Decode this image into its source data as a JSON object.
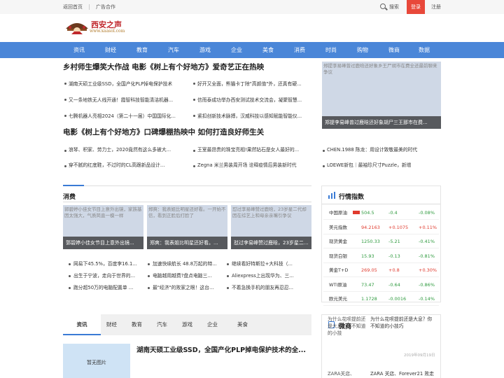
{
  "topbar": {
    "home": "返回首页",
    "ads": "广告合作",
    "search": "搜索",
    "login": "登录",
    "register": "注册"
  },
  "logo": {
    "name": "西安之声",
    "url": "www.xaasol.com"
  },
  "nav": [
    "资讯",
    "财经",
    "教育",
    "汽车",
    "游戏",
    "企业",
    "美食",
    "消费",
    "时尚",
    "购物",
    "微商",
    "数据"
  ],
  "headline1": "乡村师生爆笑大作战 电影《树上有个好地方》爱奇艺正在热映",
  "list1": [
    "湖南天硕工业级SSD，全国产化PLP掉电保护技术",
    "好开又全面，熊猫卡丁除\"高颜值\"外，还真有硬...",
    "又一条地铁无人线开通！霞智科技智能清洁机器...",
    "信而泰成功举办西安测试技术交流会，凝聚智慧...",
    "七腾机器人亮相2024（第二十一届）中国国际化...",
    "紧扣创新技术脉搏，汉威科技以感知赋能智能仪..."
  ],
  "right_img": {
    "alt": "郑提李易峰曾过鹿晗还好象乡王尸胡市在费全还最前聊来争议",
    "caption": "郑提李易峰曾过鹿晗还好象胡尸三王那市在费..."
  },
  "headline2": "电影《树上有个好地方》口碑爆棚热映中 如何打造良好师生关",
  "list2": [
    "浪琴、积家、劳力士，2020竟然有这么多被大...",
    "王室最昂贵的珠宝亮相!果然钻石是女人最好的...",
    "CHEN.1988 陈龙：用设计致敬最美的时代",
    "穿不腻的红底鞋，不过时的CL高跟新品设计...",
    "Zegna 米兰男装周开场 诠释疫情后男装新时代",
    "LOEWE新包｜最袖珍尺寸Puzzle，新增"
  ],
  "consume": {
    "title": "消费",
    "cards": [
      {
        "alt": "郭碧婷小佳女节目上意外出镜，家族基因太强大，气质简直一模一样",
        "caption": "郭碧婷小佳女节目上意外出镜..."
      },
      {
        "alt": "郑爽：我表姐比明星还好看。一开始不信，看到正脸后打脸了",
        "caption": "郑爽：我表姐比明星还好看。..."
      },
      {
        "alt": "怼过李易峰赞过鹿晗，23岁星二代却因在综艺上和母亲亲嘴引争议",
        "caption": "怼过李易峰赞过鹿晗，23岁星二..."
      }
    ],
    "list": [
      "网易下45.5%，百度李16.1...",
      "加速快续航长 48.8万起的特...",
      "继续看好特斯拉+大科技（...",
      "出生于宁波，走向于世界的...",
      "电脑越用越费?盘点电脑三...",
      "Aliexpress上出现华为、三...",
      "跑分超50万的电脑配置单 ...",
      "最\"经济\"的败家之眼！这台...",
      "不着急换手机的朋友再忍忍..."
    ]
  },
  "market": {
    "title": "行情指数",
    "rows": [
      {
        "name": "中国原油",
        "value": "504.5",
        "change": "-0.4",
        "pct": "-0.08%",
        "dir": "down"
      },
      {
        "name": "美元指数",
        "value": "94.2163",
        "change": "+0.1075",
        "pct": "+0.11%",
        "dir": "up"
      },
      {
        "name": "现货黄金",
        "value": "1250.33",
        "change": "-5.21",
        "pct": "-0.41%",
        "dir": "down"
      },
      {
        "name": "现货白银",
        "value": "15.93",
        "change": "-0.13",
        "pct": "-0.81%",
        "dir": "down"
      },
      {
        "name": "黄金T+D",
        "value": "269.05",
        "change": "+0.8",
        "pct": "+0.30%",
        "dir": "up"
      },
      {
        "name": "WTI原油",
        "value": "73.47",
        "change": "-0.64",
        "pct": "-0.86%",
        "dir": "down"
      },
      {
        "name": "欧元美元",
        "value": "1.1728",
        "change": "-0.0016",
        "pct": "-0.14%",
        "dir": "down"
      }
    ],
    "colors": {
      "up": "#e03b2e",
      "down": "#2e9a3e"
    }
  },
  "tabs": [
    "资讯",
    "财经",
    "教育",
    "汽车",
    "游戏",
    "企业",
    "美食"
  ],
  "feature": {
    "noimg": "暂无图片",
    "title": "湖南天硕工业级SSD，全国产化PLP掉电保护技术的全..."
  },
  "weishang": {
    "title": "微商",
    "item1_img": "为什么花呗提前还是大息？你不知道的小技",
    "item1_title": "为什么花呗提前还是大息？你不知道的小技巧",
    "item1_date": "2019年09月19日",
    "item2_img": "ZARA关店、",
    "item2_title": "ZARA 关店、Forever21 败走"
  }
}
